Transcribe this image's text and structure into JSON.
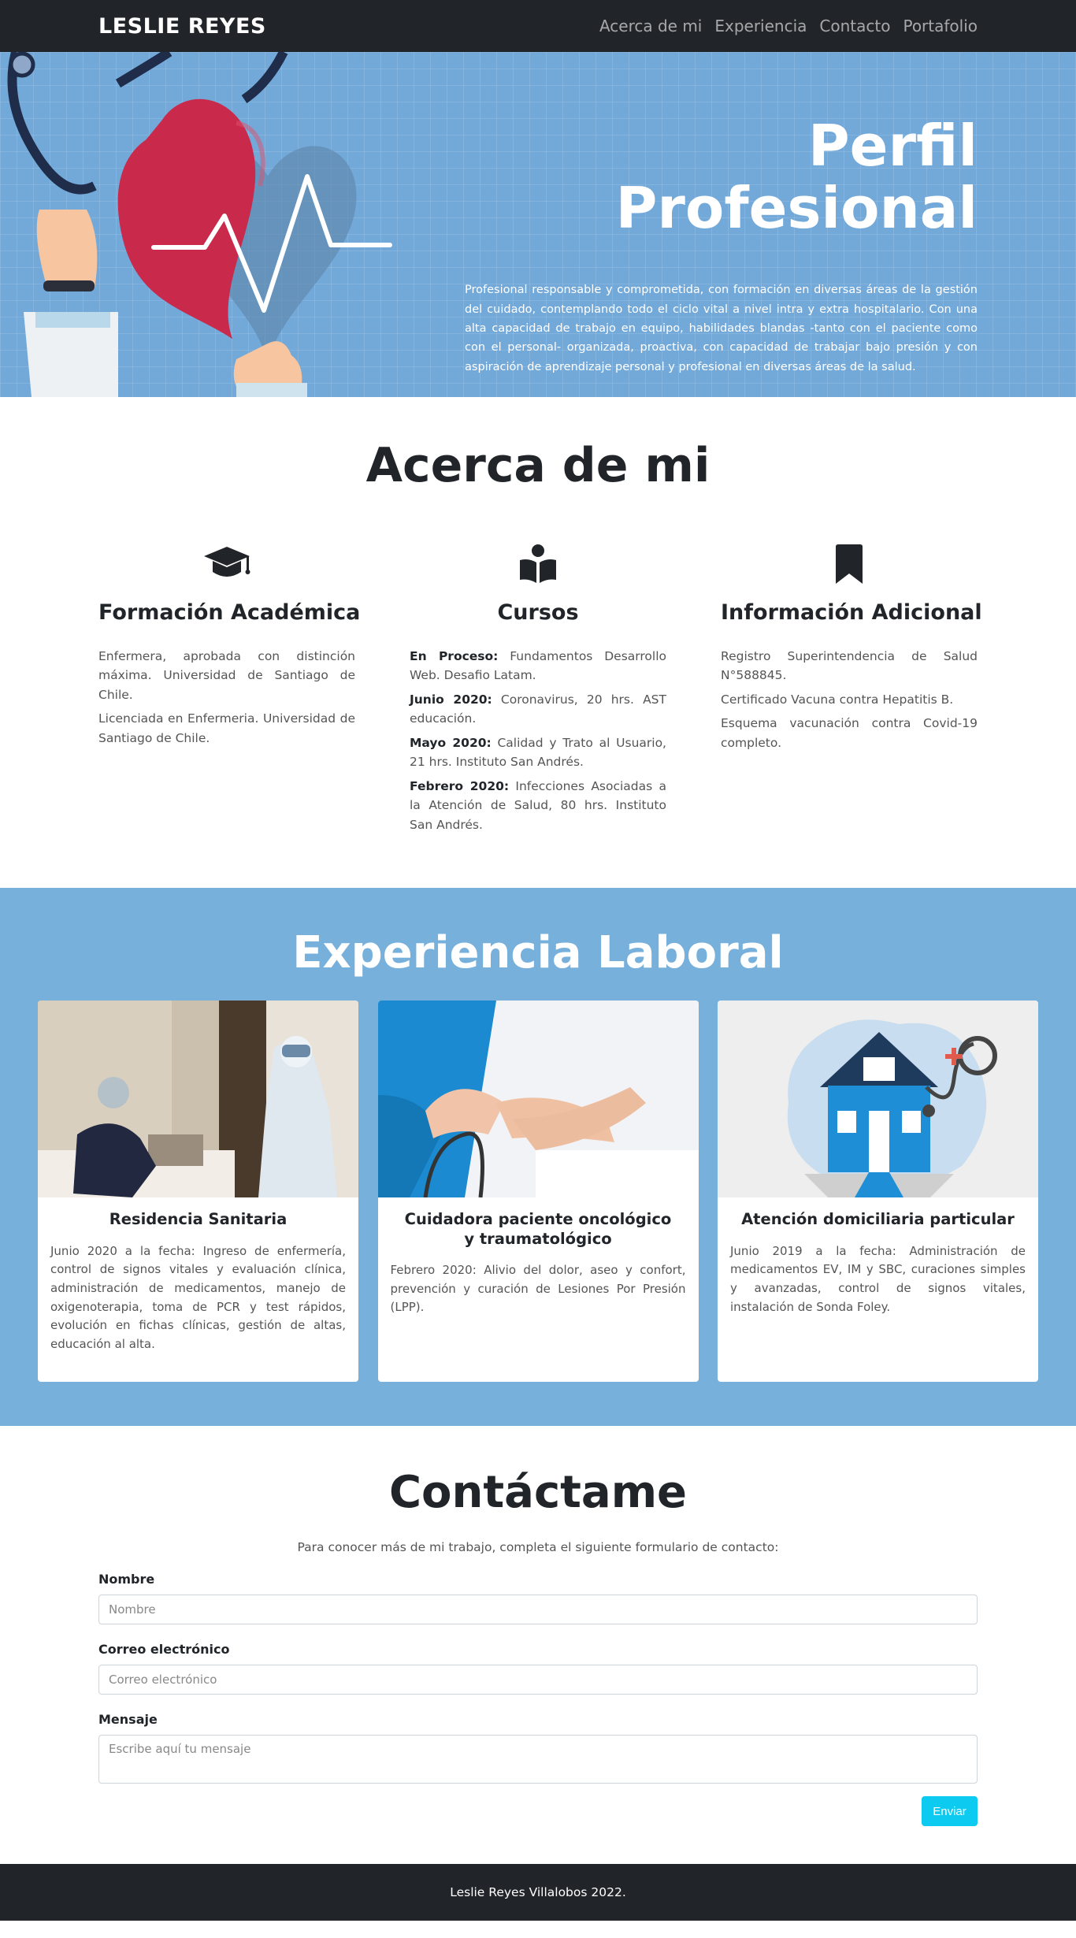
{
  "nav": {
    "brand": "LESLIE REYES",
    "links": [
      "Acerca de mi",
      "Experiencia",
      "Contacto",
      "Portafolio"
    ]
  },
  "hero": {
    "title": "Perfil Profesional",
    "description": "Profesional responsable y comprometida, con formación en diversas áreas de la gestión del cuidado, contemplando todo el ciclo vital a nivel intra y extra hospitalario. Con una alta capacidad de trabajo en equipo, habilidades blandas -tanto con el paciente como con el personal- organizada, proactiva, con capacidad de trabajar bajo presión y con aspiración de aprendizaje personal y profesional en diversas áreas de la salud."
  },
  "about": {
    "title": "Acerca de mi",
    "columns": [
      {
        "icon": "graduation-cap-icon",
        "title": "Formación Académica",
        "items": [
          {
            "lead": "",
            "text": "Enfermera, aprobada con distinción máxima. Universidad de Santiago de Chile."
          },
          {
            "lead": "",
            "text": "Licenciada en Enfermeria. Universidad de Santiago de Chile."
          }
        ]
      },
      {
        "icon": "book-reader-icon",
        "title": "Cursos",
        "items": [
          {
            "lead": "En Proceso:",
            "text": " Fundamentos Desarrollo Web. Desafio Latam."
          },
          {
            "lead": "Junio 2020:",
            "text": " Coronavirus, 20 hrs. AST educación."
          },
          {
            "lead": "Mayo 2020:",
            "text": " Calidad y Trato al Usuario, 21 hrs. Instituto San Andrés."
          },
          {
            "lead": "Febrero 2020:",
            "text": " Infecciones Asociadas a la Atención de Salud, 80 hrs. Instituto San Andrés."
          }
        ]
      },
      {
        "icon": "bookmark-icon",
        "title": "Información Adicional",
        "items": [
          {
            "lead": "",
            "text": "Registro Superintendencia de Salud N°588845."
          },
          {
            "lead": "",
            "text": "Certificado Vacuna contra Hepatitis B."
          },
          {
            "lead": "",
            "text": "Esquema vacunación contra Covid-19 completo."
          }
        ]
      }
    ]
  },
  "experience": {
    "title": "Experiencia Laboral",
    "cards": [
      {
        "title": "Residencia Sanitaria",
        "text": "Junio 2020 a la fecha: Ingreso de enfermería, control de signos vitales y evaluación clínica, administración de medicamentos, manejo de oxigenoterapia, toma de PCR y test rápidos, evolución en fichas clínicas, gestión de altas, educación al alta."
      },
      {
        "title": "Cuidadora paciente oncológico y traumatológico",
        "text": "Febrero 2020: Alivio del dolor, aseo y confort, prevención y curación de Lesiones Por Presión (LPP)."
      },
      {
        "title": "Atención domiciliaria particular",
        "text": "Junio 2019 a la fecha: Administración de medicamentos EV, IM y SBC, curaciones simples y avanzadas, control de signos vitales, instalación de Sonda Foley."
      }
    ]
  },
  "contact": {
    "title": "Contáctame",
    "lead": "Para conocer más de mi trabajo, completa el siguiente formulario de contacto:",
    "name_label": "Nombre",
    "name_placeholder": "Nombre",
    "email_label": "Correo electrónico",
    "email_placeholder": "Correo electrónico",
    "message_label": "Mensaje",
    "message_placeholder": "Escribe aquí tu mensaje",
    "submit": "Enviar"
  },
  "footer": {
    "text": "Leslie Reyes Villalobos 2022."
  },
  "colors": {
    "navbar": "#212529",
    "hero": "#73a9d9",
    "experience": "#78b0dc",
    "button": "#0dcaf0",
    "heart": "#c9294a"
  }
}
